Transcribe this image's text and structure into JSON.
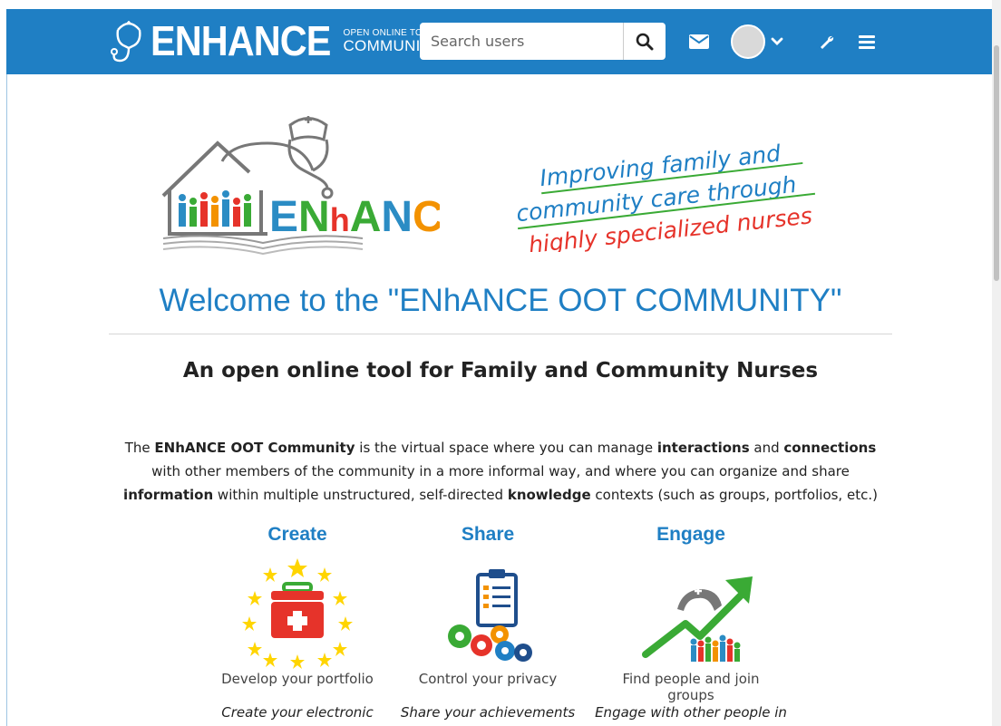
{
  "header": {
    "brand_word": "ENHANCE",
    "brand_sub1": "OPEN ONLINE TOOL",
    "brand_sub2": "COMMUNITY",
    "search_placeholder": "Search users",
    "search_value": "",
    "bar_color": "#1f7fc4",
    "icons": [
      "search-icon",
      "envelope-icon",
      "avatar",
      "chevron-down-icon",
      "wrench-icon",
      "hamburger-menu-icon"
    ]
  },
  "hero": {
    "logo_word": "ENHANCE",
    "tagline": [
      "Improving family and",
      "community care through",
      "highly specialized nurses"
    ]
  },
  "main": {
    "welcome": "Welcome to the \"ENhANCE OOT COMMUNITY\"",
    "subtitle": "An open online tool for Family and Community Nurses",
    "intro": {
      "p1": "The ",
      "b1": "ENhANCE OOT Community",
      "p2": " is the virtual space where you can manage ",
      "b2": "interactions",
      "p3": " and ",
      "b3": "connections",
      "p4": " with other members of the community in a more informal way, and where you can organize and share ",
      "b4": "information",
      "p5": " within multiple unstructured, self-directed ",
      "b5": "knowledge",
      "p6": " contexts (such as groups, portfolios, etc.)"
    },
    "features": [
      {
        "title": "Create",
        "desc": "Develop your portfolio",
        "more": "Create your electronic"
      },
      {
        "title": "Share",
        "desc": "Control your privacy",
        "more": "Share your achievements"
      },
      {
        "title": "Engage",
        "desc": "Find people and join groups",
        "more": "Engage with other people in"
      }
    ]
  }
}
